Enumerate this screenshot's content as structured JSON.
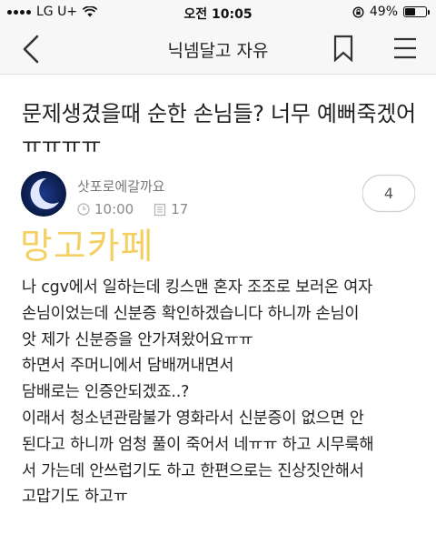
{
  "status_bar": {
    "carrier": "LG U+",
    "time": "오전 10:05",
    "battery_percent": "49%",
    "battery_level": 0.49
  },
  "nav": {
    "title": "닉넴달고 자유",
    "icons": [
      "back-arrow-icon",
      "bookmark-icon",
      "menu-icon"
    ]
  },
  "post": {
    "title": "문제생겼을때 순한 손님들? 너무 예뻐죽겠어ㅠㅠㅠㅠ",
    "author": "삿포로에갈까요",
    "time": "10:00",
    "views": "17",
    "comments": "4",
    "watermark": "망고카페",
    "body_lines": [
      "나 cgv에서 일하는데 킹스맨 혼자 조조로 보러온 여자",
      "손님이었는데 신분증 확인하겠습니다 하니까 손님이",
      "앗 제가 신분증을 안가져왔어요ㅠㅠ",
      "하면서 주머니에서 담배꺼내면서",
      "담배로는 인증안되겠죠..?",
      "이래서 청소년관람불가 영화라서 신분증이 없으면 안",
      "된다고 하니까 엄청 풀이 죽어서 네ㅠㅠ 하고 시무룩해",
      "서 가는데 안쓰럽기도 하고 한편으로는 진상짓안해서",
      "고맙기도 하고ㅠ"
    ]
  },
  "colors": {
    "watermark": "#f4d063",
    "bar_background": "#f7f7f7",
    "meta_text": "#8a8a8a"
  }
}
